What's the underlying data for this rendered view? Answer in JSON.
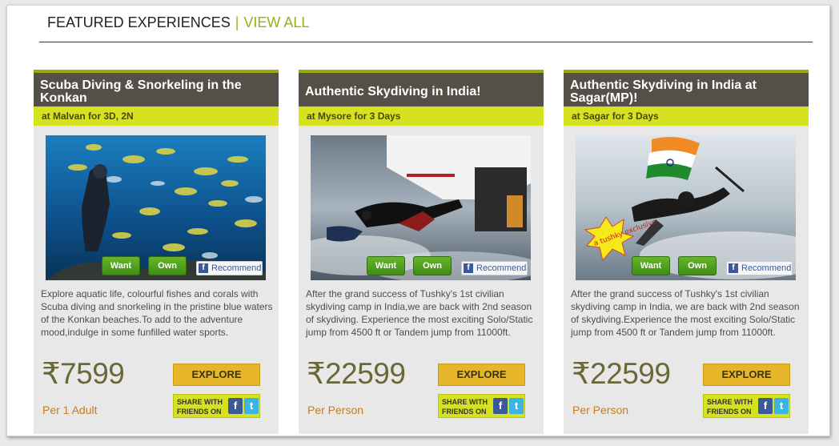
{
  "header": {
    "title": "FEATURED EXPERIENCES",
    "separator": "|",
    "view_all": "VIEW ALL"
  },
  "cards": [
    {
      "title": "Scuba Diving & Snorkeling in the Konkan",
      "location": "at Malvan for 3D, 2N",
      "want": "Want",
      "own": "Own",
      "recommend": "Recommend",
      "description": "Explore aquatic life, colourful fishes and corals with Scuba diving and snorkeling in the pristine blue waters of the Konkan beaches.To add to the adventure mood,indulge in some funfilled water sports.",
      "price": "₹7599",
      "per": "Per 1 Adult",
      "explore": "EXPLORE",
      "share": "SHARE WITH FRIENDS ON"
    },
    {
      "title": "Authentic Skydiving in India!",
      "location": "at Mysore for 3 Days",
      "want": "Want",
      "own": "Own",
      "recommend": "Recommend",
      "description": "After the grand success of Tushky's 1st civilian skydiving camp in India,we are back with 2nd season of skydiving. Experience the most exciting Solo/Static jump from 4500 ft or Tandem jump from 11000ft.",
      "price": "₹22599",
      "per": "Per Person",
      "explore": "EXPLORE",
      "share": "SHARE WITH FRIENDS ON"
    },
    {
      "title": "Authentic Skydiving in India at Sagar(MP)!",
      "location": "at Sagar for 3 Days",
      "want": "Want",
      "own": "Own",
      "recommend": "Recommend",
      "description": "After the grand success of Tushky's 1st civilian skydiving camp in India, we are back with 2nd season of skydiving.Experience the most exciting Solo/Static jump from 4500 ft or Tandem jump from 11000ft.",
      "price": "₹22599",
      "per": "Per Person",
      "explore": "EXPLORE",
      "share": "SHARE WITH FRIENDS ON",
      "badge": "a tushky exclusive"
    }
  ],
  "colors": {
    "accent": "#9fae14",
    "title_bar": "#545048",
    "location_bar": "#d6e21f",
    "explore": "#e6b52a",
    "want_own": "#4fa11e"
  }
}
